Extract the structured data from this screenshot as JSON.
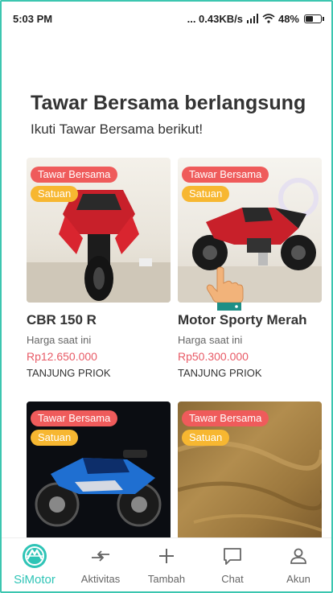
{
  "status_bar": {
    "time": "5:03 PM",
    "speed": "... 0.43KB/s",
    "battery": "48%"
  },
  "heading": {
    "title": "Tawar Bersama berlangsung",
    "subtitle": "Ikuti Tawar Bersama berikut!"
  },
  "cards": [
    {
      "badge_primary": "Tawar Bersama",
      "badge_secondary": "Satuan",
      "title": "CBR 150 R",
      "price_label": "Harga saat ini",
      "price": "Rp12.650.000",
      "location": "TANJUNG PRIOK"
    },
    {
      "badge_primary": "Tawar Bersama",
      "badge_secondary": "Satuan",
      "title": "Motor Sporty Merah",
      "price_label": "Harga saat ini",
      "price": "Rp50.300.000",
      "location": "TANJUNG PRIOK"
    },
    {
      "badge_primary": "Tawar Bersama",
      "badge_secondary": "Satuan"
    },
    {
      "badge_primary": "Tawar Bersama",
      "badge_secondary": "Satuan"
    }
  ],
  "bottom_nav": [
    {
      "label": "SiMotor",
      "icon": "simotor-logo-icon",
      "active": true
    },
    {
      "label": "Aktivitas",
      "icon": "activity-arrows-icon",
      "active": false
    },
    {
      "label": "Tambah",
      "icon": "plus-icon",
      "active": false
    },
    {
      "label": "Chat",
      "icon": "chat-bubble-icon",
      "active": false
    },
    {
      "label": "Akun",
      "icon": "user-icon",
      "active": false
    }
  ],
  "colors": {
    "accent": "#2ec4b6",
    "badge_red": "#ef5b5b",
    "badge_yellow": "#f7b731",
    "price": "#e85a66"
  }
}
